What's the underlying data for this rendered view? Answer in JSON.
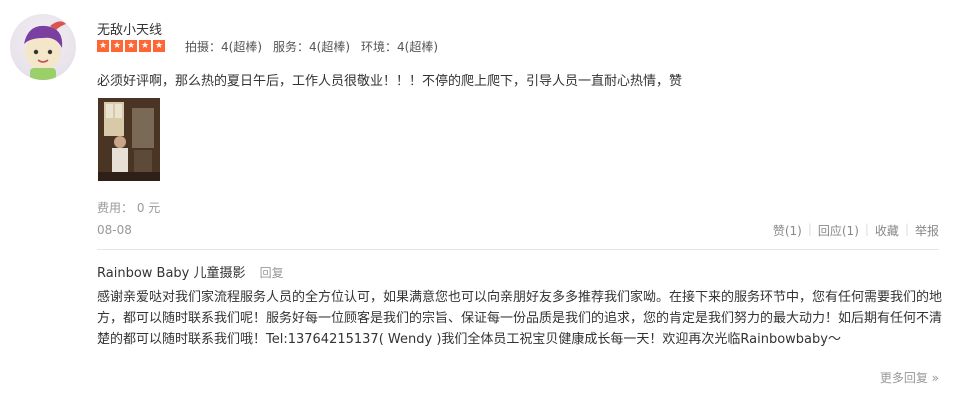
{
  "user": {
    "name": "无敌小天线",
    "stars": 5
  },
  "ratings": [
    "拍摄：4(超棒)",
    "服务：4(超棒)",
    "环境：4(超棒)"
  ],
  "review": {
    "text": "必须好评啊，那么热的夏日午后，工作人员很敬业！！！不停的爬上爬下，引导人员一直耐心热情，赞",
    "cost": "费用： 0 元",
    "date": "08-08"
  },
  "actions": {
    "like": "赞(1)",
    "reply": "回应(1)",
    "favorite": "收藏",
    "report": "举报"
  },
  "merchant_reply": {
    "author": "Rainbow Baby 儿童摄影",
    "reply_link": "回复",
    "text": "感谢亲爱哒对我们家流程服务人员的全方位认可，如果满意您也可以向亲朋好友多多推荐我们家呦。在接下来的服务环节中，您有任何需要我们的地方，都可以随时联系我们呢！服务好每一位顾客是我们的宗旨、保证每一份品质是我们的追求，您的肯定是我们努力的最大动力！如后期有任何不清楚的都可以随时联系我们哦！Tel:13764215137( Wendy )我们全体员工祝宝贝健康成长每一天！欢迎再次光临Rainbowbaby～"
  },
  "more_replies": "更多回复 »",
  "colors": {
    "star": "#ff6633",
    "muted": "#999999",
    "text": "#333333"
  }
}
